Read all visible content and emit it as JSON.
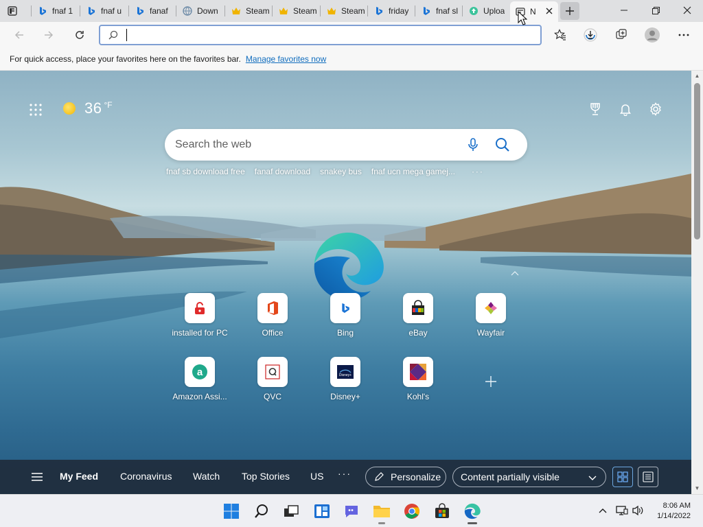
{
  "browser": {
    "tabs": [
      {
        "title": "fnaf 1",
        "icon": "bing-icon"
      },
      {
        "title": "fnaf u",
        "icon": "bing-icon"
      },
      {
        "title": "fanaf",
        "icon": "bing-icon"
      },
      {
        "title": "Down",
        "icon": "globe-icon"
      },
      {
        "title": "Steam",
        "icon": "crown-icon"
      },
      {
        "title": "Steam",
        "icon": "crown-icon"
      },
      {
        "title": "Steam",
        "icon": "crown-icon"
      },
      {
        "title": "friday",
        "icon": "bing-icon"
      },
      {
        "title": "fnaf sl",
        "icon": "bing-icon"
      },
      {
        "title": "Uploa",
        "icon": "upload-site-icon"
      },
      {
        "title": "N",
        "icon": "newtab-icon",
        "active": true
      }
    ],
    "address_value": "",
    "favorites_bar": {
      "message": "For quick access, place your favorites here on the favorites bar.",
      "link": "Manage favorites now"
    }
  },
  "newtab": {
    "weather": {
      "temp": "36",
      "unit": "°F",
      "icon": "sun-icon"
    },
    "search": {
      "placeholder": "Search the web"
    },
    "suggestions": [
      "fnaf sb download free",
      "fanaf download",
      "snakey bus",
      "fnaf ucn mega gamej..."
    ],
    "more_label": "···",
    "quick_links": [
      {
        "label": "installed for PC",
        "icon": "lock-app-icon"
      },
      {
        "label": "Office",
        "icon": "office-icon"
      },
      {
        "label": "Bing",
        "icon": "bing-icon"
      },
      {
        "label": "eBay",
        "icon": "ebay-icon"
      },
      {
        "label": "Wayfair",
        "icon": "wayfair-icon"
      },
      {
        "label": "Amazon Assi...",
        "icon": "amazon-assistant-icon"
      },
      {
        "label": "QVC",
        "icon": "qvc-icon"
      },
      {
        "label": "Disney+",
        "icon": "disney-plus-icon"
      },
      {
        "label": "Kohl's",
        "icon": "kohls-icon"
      }
    ],
    "feed": {
      "tabs": [
        "My Feed",
        "Coronavirus",
        "Watch",
        "Top Stories",
        "US"
      ],
      "more": "···",
      "personalize": "Personalize",
      "visibility": "Content partially visible"
    }
  },
  "taskbar": {
    "time": "8:06 AM",
    "date": "1/14/2022"
  }
}
